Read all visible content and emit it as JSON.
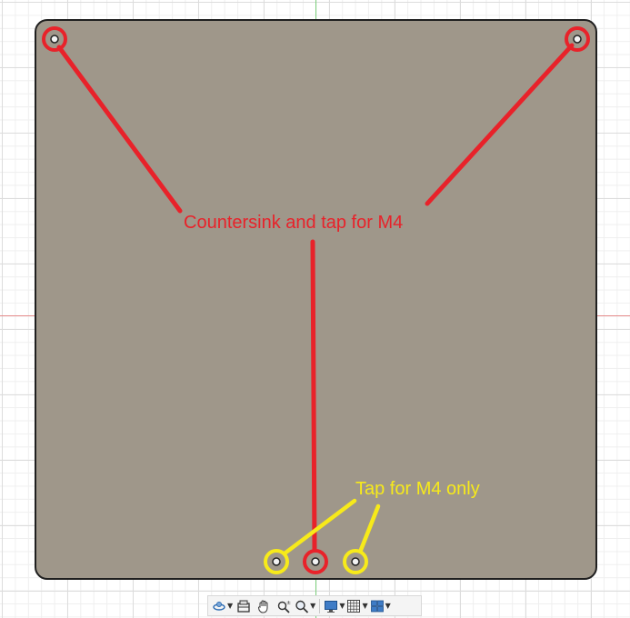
{
  "canvas": {
    "plate_color": "#9f978a",
    "plate_border_color": "#1f1f1f",
    "grid_color": "#dcdcdc"
  },
  "annotations": {
    "countersink_label": "Countersink and tap for M4",
    "countersink_color": "#e8222a",
    "tap_label": "Tap for M4 only",
    "tap_color": "#f7ea1a"
  },
  "holes": {
    "countersink_count": 3,
    "tap_only_count": 2
  },
  "toolbar": {
    "items": [
      {
        "name": "orbit-icon",
        "has_menu": true
      },
      {
        "name": "look-at-icon",
        "has_menu": false
      },
      {
        "name": "pan-hand-icon",
        "has_menu": false
      },
      {
        "name": "zoom-icon",
        "has_menu": false
      },
      {
        "name": "fit-zoom-icon",
        "has_menu": true
      },
      {
        "name": "display-settings-icon",
        "has_menu": true
      },
      {
        "name": "grid-icon",
        "has_menu": true
      },
      {
        "name": "viewports-icon",
        "has_menu": true
      }
    ]
  }
}
